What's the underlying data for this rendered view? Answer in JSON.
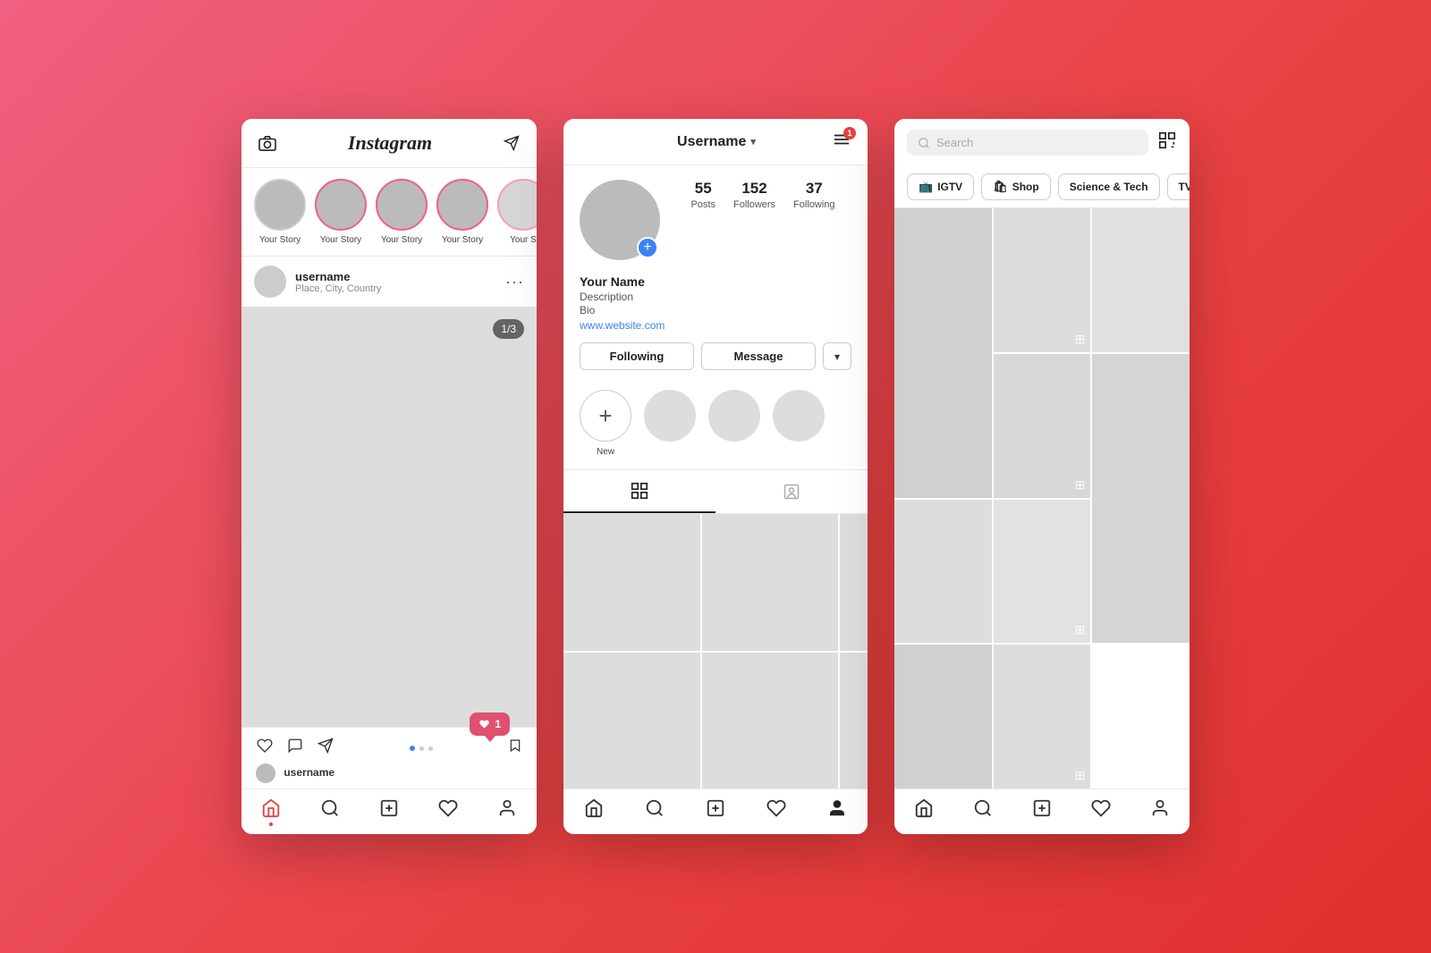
{
  "background": {
    "gradient_start": "#f06080",
    "gradient_end": "#e03030"
  },
  "phone1": {
    "header": {
      "title": "Instagram",
      "camera_icon": "📷",
      "send_icon": "✈"
    },
    "stories": [
      {
        "label": "Your Story",
        "has_ring": false
      },
      {
        "label": "Your Story",
        "has_ring": true
      },
      {
        "label": "Your Story",
        "has_ring": true
      },
      {
        "label": "Your Story",
        "has_ring": true
      },
      {
        "label": "Your S",
        "has_ring": true
      }
    ],
    "post": {
      "username": "username",
      "location": "Place, City, Country",
      "counter": "1/3"
    },
    "notification": {
      "count": "1"
    },
    "caption_user": "username",
    "nav": {
      "home": "🏠",
      "search": "🔍",
      "add": "➕",
      "heart": "♡",
      "profile": "👤"
    }
  },
  "phone2": {
    "header": {
      "username": "Username",
      "chevron": "▾",
      "menu_badge": "1"
    },
    "stats": {
      "posts": {
        "value": "55",
        "label": "Posts"
      },
      "followers": {
        "value": "152",
        "label": "Followers"
      },
      "following": {
        "value": "37",
        "label": "Following"
      }
    },
    "profile": {
      "name": "Your Name",
      "description": "Description",
      "bio": "Bio",
      "website": "www.website.com"
    },
    "actions": {
      "following": "Following",
      "message": "Message",
      "chevron": "▾"
    },
    "highlights": {
      "new_label": "New",
      "circles": 3
    },
    "tabs": {
      "grid": "grid",
      "tag": "tag"
    },
    "nav": {
      "home": "home",
      "search": "search",
      "add": "add",
      "heart": "heart",
      "profile": "profile"
    }
  },
  "phone3": {
    "search": {
      "placeholder": "Search"
    },
    "categories": [
      {
        "icon": "📺",
        "label": "IGTV"
      },
      {
        "icon": "🛍",
        "label": "Shop"
      },
      {
        "icon": "",
        "label": "Science & Tech"
      },
      {
        "icon": "",
        "label": "TV & mov"
      }
    ],
    "nav": {
      "home": "home",
      "search": "search",
      "add": "add",
      "heart": "heart",
      "profile": "profile"
    }
  }
}
